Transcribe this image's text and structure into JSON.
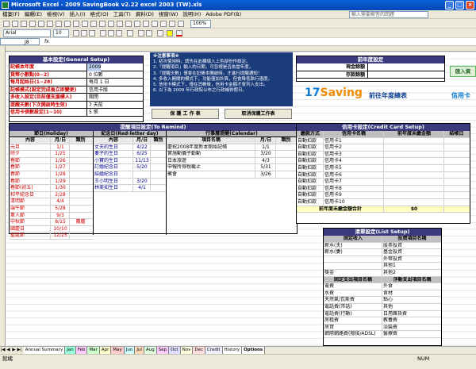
{
  "window": {
    "title": "Microsoft Excel - 2009 SavingBook v2.22 excel 2003 (TW).xls"
  },
  "menu": {
    "items": [
      "檔案(F)",
      "編輯(E)",
      "檢視(V)",
      "插入(I)",
      "格式(O)",
      "工具(T)",
      "資料(D)",
      "視窗(W)",
      "說明(H)",
      "Adobe PDF(B)"
    ],
    "help_placeholder": "輸入需要解答的問題"
  },
  "toolbar": {
    "font_name": "Arial",
    "font_size": "10",
    "zoom": "100%"
  },
  "formula_bar": {
    "cell_ref": "J8",
    "fx": "fx"
  },
  "basic_settings": {
    "title": "基本設定(General Setup)",
    "rows": [
      {
        "label": "記帳本年度",
        "value": "2009"
      },
      {
        "label": "貨幣小數點(0~2)",
        "value": "0 位數"
      },
      {
        "label": "每月起始日(1~28)",
        "value": "每月 1 日"
      },
      {
        "label": "記帳模式(設定完成後立即變更)",
        "value": "信用卡版"
      },
      {
        "label": "多收入設定(目前僅支援標人)",
        "value": "關閉"
      },
      {
        "label": "提醒天數(下次開啟時生效)",
        "value": "7 天前"
      },
      {
        "label": "信用卡張數設定(1~10)",
        "value": "5 張"
      }
    ]
  },
  "notice": {
    "title": "※注意事項※",
    "lines": [
      "1. 初次使用時，請先在此欄填入上色部份作設定。",
      "2.「提醒項目」輸入的日期，可忽視是否為當年度。",
      "3.「提醒天數」僅會在記帳本開啟時，才進行提醒通知！",
      "4. 多收入開關的模式下，功能僅加計算，但會降低執行速度。",
      "5. 信用卡模式下，僅在消帳後，信用卡金額才會列入支出。",
      "6. 以下為 2009 年行政院公布之行政補休假日。"
    ]
  },
  "buttons": {
    "save_sheet": "保 護 工 作 表",
    "unprotect_sheet": "取消保護工作表"
  },
  "logo": {
    "brand_a": "17",
    "brand_b": "Saving",
    "tagline": "前往年度總表",
    "side_link": "信用卡",
    "side_tab": "匯入資"
  },
  "prev_year": {
    "title": "前年度設定",
    "rows": [
      {
        "label": "現金餘額",
        "value": ""
      },
      {
        "label": "存款餘額",
        "value": ""
      }
    ]
  },
  "remind": {
    "title": "提醒項目設定(To Remind)",
    "holiday_title": "節日(Holiday)",
    "memorial_title": "紀念日(Red-letter day)",
    "calendar_title": "行事曆提醒(Calendar)",
    "col_content": "內容",
    "col_date": "月/日",
    "col_type": "類別",
    "col_item": "項目名稱",
    "holidays": [
      {
        "name": "元旦",
        "date": "1/1",
        "type": ""
      },
      {
        "name": "除夕",
        "date": "1/25",
        "type": ""
      },
      {
        "name": "春節",
        "date": "1/26",
        "type": ""
      },
      {
        "name": "春節",
        "date": "1/27",
        "type": ""
      },
      {
        "name": "春節",
        "date": "1/28",
        "type": ""
      },
      {
        "name": "春節",
        "date": "1/29",
        "type": ""
      },
      {
        "name": "春節(初五)",
        "date": "1/30",
        "type": ""
      },
      {
        "name": "和平紀念日",
        "date": "2/28",
        "type": ""
      },
      {
        "name": "清明節",
        "date": "4/4",
        "type": ""
      },
      {
        "name": "端午節",
        "date": "5/28",
        "type": ""
      },
      {
        "name": "軍人節",
        "date": "9/3",
        "type": ""
      },
      {
        "name": "中秋節",
        "date": "8/15",
        "type": "農曆"
      },
      {
        "name": "國慶日",
        "date": "10/10",
        "type": ""
      },
      {
        "name": "聖誕節",
        "date": "12/25",
        "type": ""
      }
    ],
    "memorials": [
      {
        "name": "丈夫的生日",
        "date": "4/22"
      },
      {
        "name": "妻子的生日",
        "date": "6/25"
      },
      {
        "name": "小寶的生日",
        "date": "11/13"
      },
      {
        "name": "訂婚紀念日",
        "date": "5/20"
      },
      {
        "name": "結婚紀念日",
        "date": ""
      },
      {
        "name": "王小明生日",
        "date": "3/20"
      },
      {
        "name": "林美如生日",
        "date": "4/1"
      }
    ],
    "calendar": [
      {
        "name": "慶祝2008年度新本開始記帳",
        "date": "1/1"
      },
      {
        "name": "實施動儀子勤動",
        "date": "3/20"
      },
      {
        "name": "日本旅遊",
        "date": "4/3"
      },
      {
        "name": "申報所得稅截止",
        "date": "5/31"
      },
      {
        "name": "聚會",
        "date": "3/26"
      }
    ]
  },
  "credit_card": {
    "title": "信用卡設定(Credit Card Setup)",
    "col_method": "繳款方式",
    "col_name": "信用卡名稱",
    "col_prev": "前年度未繳金額",
    "col_close": "結帳日",
    "cards": [
      {
        "method": "自動扣款",
        "name": "信用卡1"
      },
      {
        "method": "自動扣款",
        "name": "信用卡2"
      },
      {
        "method": "自動扣款",
        "name": "信用卡3"
      },
      {
        "method": "自動扣款",
        "name": "信用卡4"
      },
      {
        "method": "自動扣款",
        "name": "信用卡5"
      },
      {
        "method": "自動扣款",
        "name": "信用卡6"
      },
      {
        "method": "自動扣款",
        "name": "信用卡7"
      },
      {
        "method": "自動扣款",
        "name": "信用卡8"
      },
      {
        "method": "自動扣款",
        "name": "信用卡9"
      },
      {
        "method": "自動扣款",
        "name": "信用卡10"
      }
    ],
    "total_label": "前年度未繳金額合計",
    "total_value": "$0"
  },
  "list_setup": {
    "title": "清單設定(List Setup)",
    "col_fixed_income": "固定收入",
    "col_invest": "投資項目名稱",
    "income_rows": [
      {
        "a": "薪水(夫)",
        "b": "股票投資"
      },
      {
        "a": "薪水(妻)",
        "b": "基金投資"
      },
      {
        "a": "",
        "b": "外幣投資"
      },
      {
        "a": "",
        "b": "其他1"
      },
      {
        "a": "獎金",
        "b": "其他2"
      }
    ],
    "col_fixed_expense": "固定支出項目名稱",
    "col_float_expense": "浮動支出項目名稱",
    "expense_rows": [
      {
        "a": "電費",
        "b": "外食"
      },
      {
        "a": "水費",
        "b": "食材"
      },
      {
        "a": "天然氣/瓦斯費",
        "b": "點心"
      },
      {
        "a": "電話費(市話)",
        "b": "其他"
      },
      {
        "a": "電話費(行動)",
        "b": "日用雜貨費"
      },
      {
        "a": "房租費",
        "b": "教養費"
      },
      {
        "a": "房貸",
        "b": "治裝費"
      },
      {
        "a": "網際網路費(撥接/ADSL)",
        "b": "醫療費"
      }
    ]
  },
  "sheet_tabs": [
    "Annual Summary",
    "Jan",
    "Feb",
    "Mar",
    "Apr",
    "May",
    "Jun",
    "Jul",
    "Aug",
    "Sep",
    "Oct",
    "Nov",
    "Dec",
    "Credit",
    "History",
    "Options"
  ],
  "status": {
    "left": "就緒",
    "right": "NUM"
  }
}
